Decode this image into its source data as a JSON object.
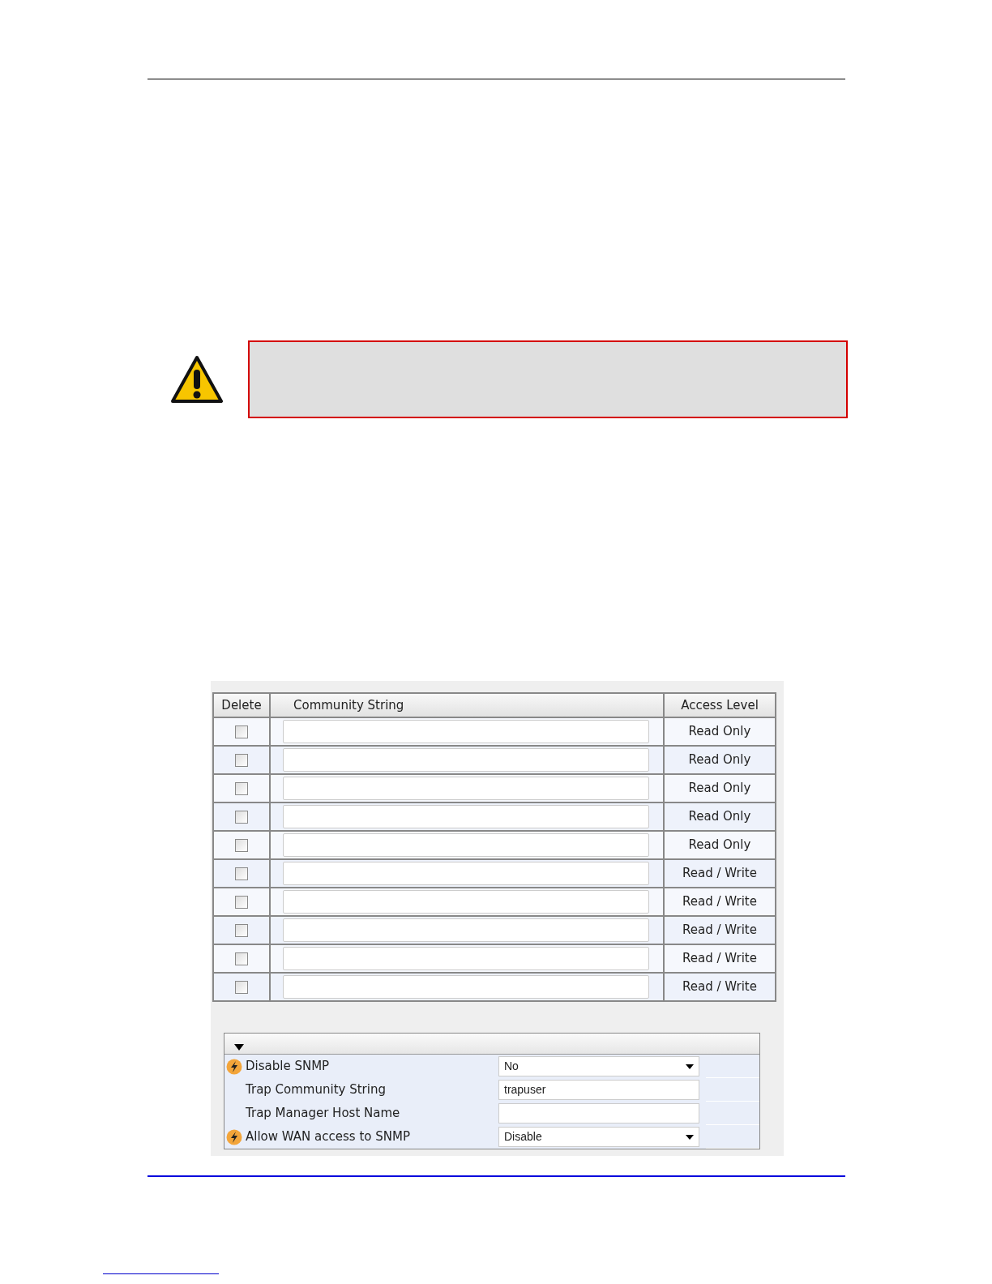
{
  "community_table": {
    "columns": [
      "Delete",
      "Community String",
      "Access Level"
    ],
    "rows": [
      {
        "checked": false,
        "access_level": "Read Only"
      },
      {
        "checked": false,
        "access_level": "Read Only"
      },
      {
        "checked": false,
        "access_level": "Read Only"
      },
      {
        "checked": false,
        "access_level": "Read Only"
      },
      {
        "checked": false,
        "access_level": "Read Only"
      },
      {
        "checked": false,
        "access_level": "Read / Write"
      },
      {
        "checked": false,
        "access_level": "Read / Write"
      },
      {
        "checked": false,
        "access_level": "Read / Write"
      },
      {
        "checked": false,
        "access_level": "Read / Write"
      },
      {
        "checked": false,
        "access_level": "Read / Write"
      }
    ]
  },
  "settings": {
    "expanded": true,
    "rows": [
      {
        "label": "Disable SNMP",
        "flagged": true,
        "kind": "select",
        "value": "No"
      },
      {
        "label": "Trap Community String",
        "flagged": false,
        "kind": "text",
        "value": "trapuser"
      },
      {
        "label": "Trap Manager Host Name",
        "flagged": false,
        "kind": "text"
      },
      {
        "label": "Allow WAN access to SNMP",
        "flagged": true,
        "kind": "select",
        "value": "Disable"
      }
    ]
  }
}
